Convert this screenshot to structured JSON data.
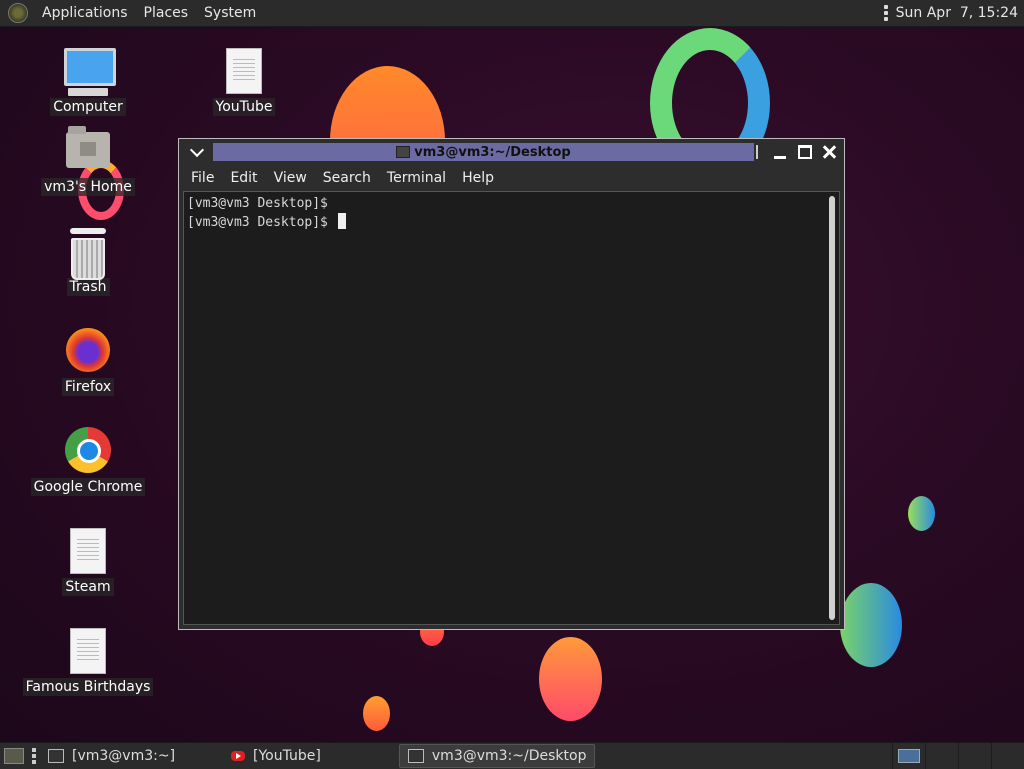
{
  "top_panel": {
    "menus": [
      "Applications",
      "Places",
      "System"
    ],
    "clock": "Sun Apr  7, 15:24"
  },
  "desktop_icons": [
    {
      "label": "Computer",
      "icon": "computer-icon"
    },
    {
      "label": "YouTube",
      "icon": "document-icon"
    },
    {
      "label": "vm3's Home",
      "icon": "home-folder-icon"
    },
    {
      "label": "Trash",
      "icon": "trash-icon"
    },
    {
      "label": "Firefox",
      "icon": "firefox-icon"
    },
    {
      "label": "Google Chrome",
      "icon": "chrome-icon"
    },
    {
      "label": "Steam",
      "icon": "document-icon"
    },
    {
      "label": "Famous Birthdays",
      "icon": "document-icon"
    }
  ],
  "terminal": {
    "title": "vm3@vm3:~/Desktop",
    "menu": [
      "File",
      "Edit",
      "View",
      "Search",
      "Terminal",
      "Help"
    ],
    "lines": [
      "[vm3@vm3 Desktop]$",
      "[vm3@vm3 Desktop]$ "
    ]
  },
  "taskbar": {
    "items": [
      "[vm3@vm3:~]",
      "[YouTube]",
      "vm3@vm3:~/Desktop"
    ]
  },
  "colors": {
    "panel": "#2b2b2b",
    "title_highlight": "#6b6aa3",
    "terminal_bg": "#1c1c1c",
    "desktop_bg": "#2a0a24"
  }
}
